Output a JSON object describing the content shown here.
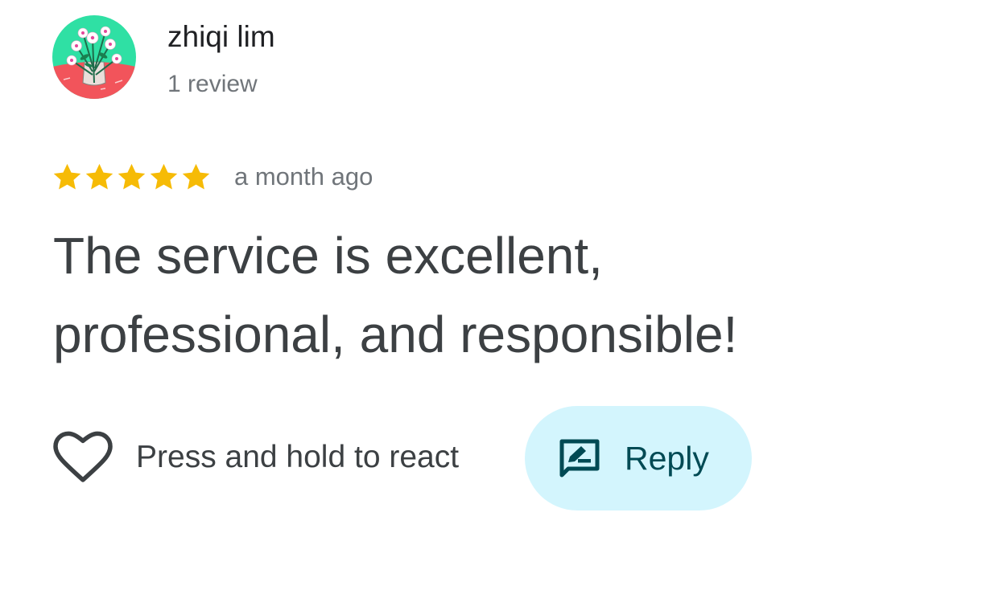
{
  "author": {
    "name": "zhiqi lim",
    "review_count": "1 review",
    "avatar_icon": "flower-vase-avatar"
  },
  "review": {
    "rating": 5,
    "rating_max": 5,
    "star_icon": "star-icon",
    "star_color": "#f6bb06",
    "time": "a month ago",
    "text_line_1": "The service is excellent,",
    "text_line_2": "professional, and responsible!"
  },
  "actions": {
    "react_icon": "heart-outline-icon",
    "react_label": "Press and hold to react",
    "reply_icon": "reply-edit-icon",
    "reply_label": "Reply",
    "reply_background": "#d3f5fd",
    "reply_text_color": "#004a54"
  }
}
